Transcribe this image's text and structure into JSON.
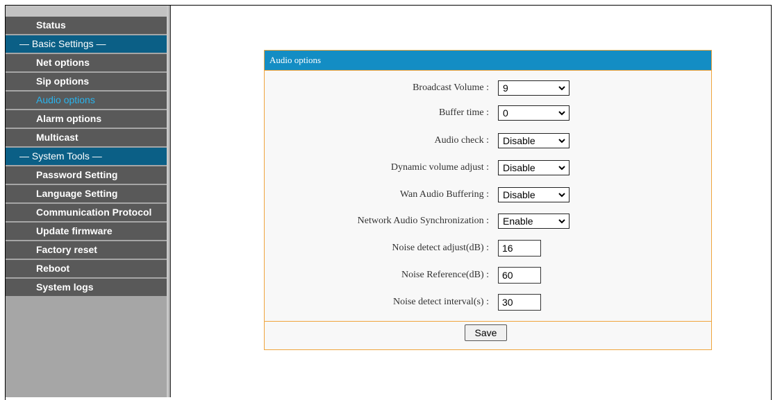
{
  "sidebar": {
    "items": [
      {
        "label": "Status",
        "type": "item"
      },
      {
        "label": "— Basic Settings —",
        "type": "section"
      },
      {
        "label": "Net options",
        "type": "item"
      },
      {
        "label": "Sip options",
        "type": "item"
      },
      {
        "label": "Audio options",
        "type": "item",
        "active": true
      },
      {
        "label": "Alarm options",
        "type": "item"
      },
      {
        "label": "Multicast",
        "type": "item"
      },
      {
        "label": "— System Tools —",
        "type": "section"
      },
      {
        "label": "Password Setting",
        "type": "item"
      },
      {
        "label": "Language Setting",
        "type": "item"
      },
      {
        "label": "Communication Protocol",
        "type": "item"
      },
      {
        "label": "Update firmware",
        "type": "item"
      },
      {
        "label": "Factory reset",
        "type": "item"
      },
      {
        "label": "Reboot",
        "type": "item"
      },
      {
        "label": "System logs",
        "type": "item"
      }
    ]
  },
  "panel": {
    "title": "Audio options",
    "fields": [
      {
        "label": "Broadcast Volume :",
        "value": "9"
      },
      {
        "label": "Buffer time :",
        "value": "0"
      },
      {
        "label": "Audio check :",
        "value": "Disable"
      },
      {
        "label": "Dynamic volume adjust :",
        "value": "Disable"
      },
      {
        "label": "Wan Audio Buffering :",
        "value": "Disable"
      },
      {
        "label": "Network Audio Synchronization :",
        "value": "Enable"
      },
      {
        "label": "Noise detect adjust(dB) :",
        "value": "16"
      },
      {
        "label": "Noise Reference(dB) :",
        "value": "60"
      },
      {
        "label": "Noise detect interval(s) :",
        "value": "30"
      }
    ],
    "save_label": "Save"
  },
  "colors": {
    "accent": "#138dc4",
    "section_bg": "#0b5f86",
    "menu_bg": "#595959",
    "active_text": "#2ab4ee",
    "panel_border": "#f0a43c"
  },
  "icons": {
    "dropdown": "chevron-down-icon"
  }
}
